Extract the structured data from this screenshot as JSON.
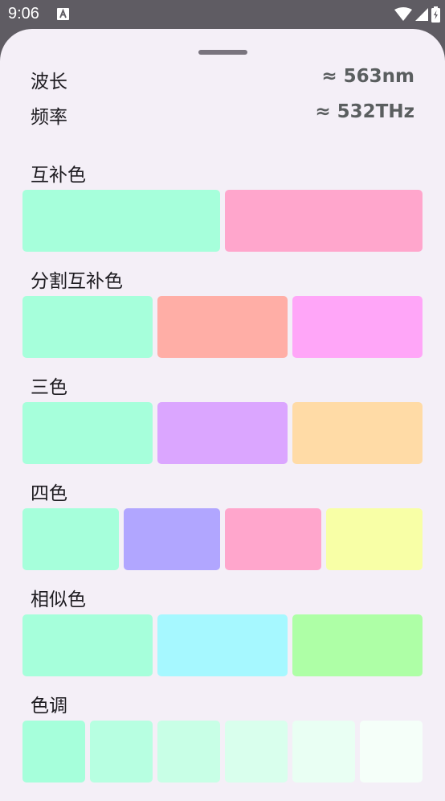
{
  "status_bar": {
    "time": "9:06",
    "app_icon": "a-letter-icon",
    "wifi_icon": "wifi-icon",
    "signal_icon": "cell-signal-icon",
    "battery_icon": "battery-icon"
  },
  "info": {
    "wavelength_label": "波长",
    "wavelength_value": "≈ 563nm",
    "frequency_label": "频率",
    "frequency_value": "≈ 532THz"
  },
  "sections": [
    {
      "title": "互补色",
      "colors": [
        "#a6ffdb",
        "#ffa6cc"
      ]
    },
    {
      "title": "分割互补色",
      "colors": [
        "#a6ffdb",
        "#ffaea6",
        "#ffa6f8"
      ]
    },
    {
      "title": "三色",
      "colors": [
        "#a6ffdb",
        "#dba6ff",
        "#ffdba6"
      ]
    },
    {
      "title": "四色",
      "colors": [
        "#a6ffdb",
        "#b1a6ff",
        "#ffa6cc",
        "#f8ffa6"
      ]
    },
    {
      "title": "相似色",
      "colors": [
        "#a6ffdb",
        "#a6f8ff",
        "#aeffa6"
      ]
    },
    {
      "title": "色调",
      "colors": [
        "#a6ffdb",
        "#b7ffe1",
        "#c8ffe6",
        "#d9ffed",
        "#e9fff3",
        "#f5fff9"
      ]
    }
  ]
}
